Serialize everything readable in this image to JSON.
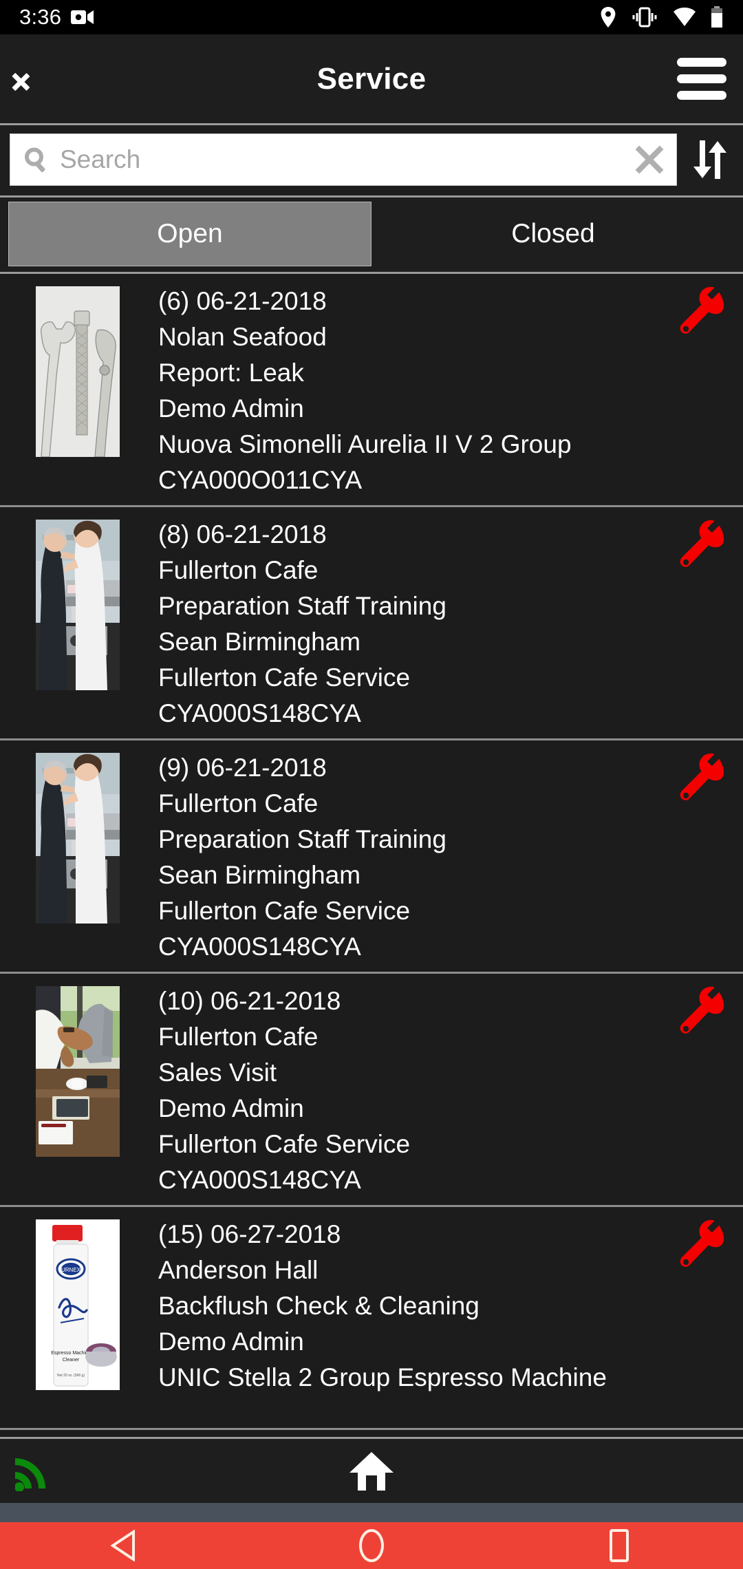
{
  "status_bar": {
    "time": "3:36",
    "left_icons": [
      "video-camera-icon"
    ],
    "right_icons": [
      "location-pin-icon",
      "vibrate-icon",
      "wifi-icon",
      "battery-icon"
    ]
  },
  "header": {
    "title": "Service",
    "back_icon": "chevron-left-icon",
    "menu_icon": "hamburger-menu-icon"
  },
  "search": {
    "placeholder": "Search",
    "value": "",
    "search_icon": "search-icon",
    "clear_icon": "clear-x-icon",
    "sort_icon": "sort-arrows-icon"
  },
  "tabs": {
    "items": [
      {
        "label": "Open",
        "active": true
      },
      {
        "label": "Closed",
        "active": false
      }
    ]
  },
  "list": {
    "items": [
      {
        "thumbnail": "wrench-and-plumbing-tools-photo",
        "status_icon": "wrench-icon",
        "status_color": "#f40000",
        "line1": "(6) 06-21-2018",
        "line2": "Nolan Seafood",
        "line3": "Report: Leak",
        "line4": "Demo Admin",
        "line5": "Nuova Simonelli Aurelia II V 2 Group",
        "line6": "CYA000O011CYA"
      },
      {
        "thumbnail": "barista-training-photo",
        "status_icon": "wrench-icon",
        "status_color": "#f40000",
        "line1": "(8) 06-21-2018",
        "line2": "Fullerton Cafe",
        "line3": "Preparation Staff Training",
        "line4": "Sean Birmingham",
        "line5": "Fullerton Cafe Service",
        "line6": "CYA000S148CYA"
      },
      {
        "thumbnail": "barista-training-photo",
        "status_icon": "wrench-icon",
        "status_color": "#f40000",
        "line1": "(9) 06-21-2018",
        "line2": "Fullerton Cafe",
        "line3": "Preparation Staff Training",
        "line4": "Sean Birmingham",
        "line5": "Fullerton Cafe Service",
        "line6": "CYA000S148CYA"
      },
      {
        "thumbnail": "handshake-meeting-photo",
        "status_icon": "wrench-icon",
        "status_color": "#f40000",
        "line1": "(10) 06-21-2018",
        "line2": "Fullerton Cafe",
        "line3": "Sales Visit",
        "line4": "Demo Admin",
        "line5": "Fullerton Cafe Service",
        "line6": "CYA000S148CYA"
      },
      {
        "thumbnail": "urnex-cafiza-cleaner-bottle-photo",
        "status_icon": "wrench-icon",
        "status_color": "#f40000",
        "line1": "(15) 06-27-2018",
        "line2": "Anderson Hall",
        "line3": "Backflush Check & Cleaning",
        "line4": "Demo Admin",
        "line5": "UNIC Stella 2 Group Espresso Machine",
        "line6": ""
      }
    ]
  },
  "bottom_bar": {
    "rss_icon": "rss-signal-icon",
    "rss_color": "#0b8a0b",
    "home_icon": "home-icon"
  },
  "android_nav": {
    "background": "#ef4237",
    "back_icon": "nav-back-triangle-icon",
    "home_icon": "nav-home-circle-icon",
    "recents_icon": "nav-recents-square-icon"
  },
  "colors": {
    "app_background": "#1c1c1c",
    "bar_background": "#1e1e1e",
    "divider": "#8d8d8d",
    "tab_active": "#808080",
    "accent_red": "#f40000"
  }
}
